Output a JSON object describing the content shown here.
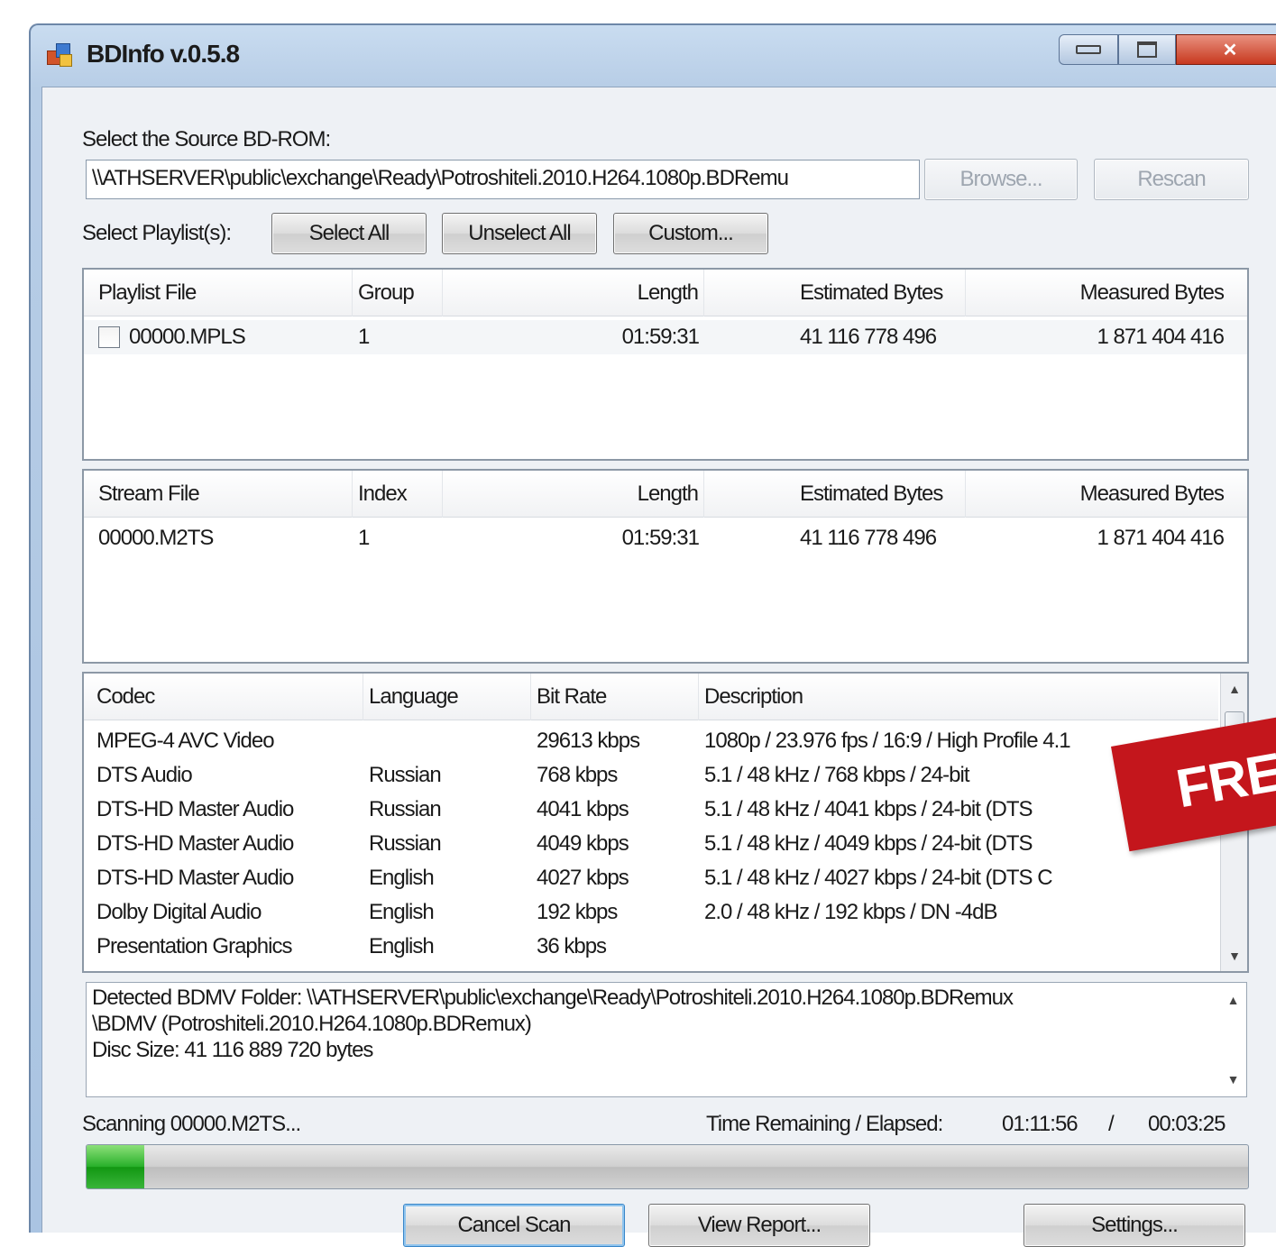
{
  "window": {
    "title": "BDInfo v.0.5.8"
  },
  "source": {
    "label": "Select the Source BD-ROM:",
    "path": "\\\\ATHSERVER\\public\\exchange\\Ready\\Potroshiteli.2010.H264.1080p.BDRemu",
    "browse": "Browse...",
    "rescan": "Rescan"
  },
  "playlists": {
    "label": "Select Playlist(s):",
    "select_all": "Select All",
    "unselect_all": "Unselect All",
    "custom": "Custom...",
    "columns": [
      "Playlist File",
      "Group",
      "Length",
      "Estimated Bytes",
      "Measured Bytes"
    ],
    "rows": [
      {
        "file": "00000.MPLS",
        "group": "1",
        "length": "01:59:31",
        "estimated": "41 116 778 496",
        "measured": "1 871 404 416",
        "checked": false
      }
    ]
  },
  "streams": {
    "columns": [
      "Stream File",
      "Index",
      "Length",
      "Estimated Bytes",
      "Measured Bytes"
    ],
    "rows": [
      {
        "file": "00000.M2TS",
        "index": "1",
        "length": "01:59:31",
        "estimated": "41 116 778 496",
        "measured": "1 871 404 416"
      }
    ]
  },
  "codecs": {
    "columns": [
      "Codec",
      "Language",
      "Bit Rate",
      "Description"
    ],
    "rows": [
      {
        "codec": "MPEG-4 AVC Video",
        "language": "",
        "bitrate": "29613 kbps",
        "description": "1080p / 23.976 fps / 16:9 / High Profile 4.1"
      },
      {
        "codec": "DTS Audio",
        "language": "Russian",
        "bitrate": "768 kbps",
        "description": "5.1 / 48 kHz / 768 kbps / 24-bit"
      },
      {
        "codec": "DTS-HD Master Audio",
        "language": "Russian",
        "bitrate": "4041 kbps",
        "description": "5.1 / 48 kHz / 4041 kbps / 24-bit (DTS"
      },
      {
        "codec": "DTS-HD Master Audio",
        "language": "Russian",
        "bitrate": "4049 kbps",
        "description": "5.1 / 48 kHz / 4049 kbps / 24-bit (DTS"
      },
      {
        "codec": "DTS-HD Master Audio",
        "language": "English",
        "bitrate": "4027 kbps",
        "description": "5.1 / 48 kHz / 4027 kbps / 24-bit (DTS C"
      },
      {
        "codec": "Dolby Digital Audio",
        "language": "English",
        "bitrate": "192 kbps",
        "description": "2.0 / 48 kHz / 192 kbps / DN -4dB"
      },
      {
        "codec": "Presentation Graphics",
        "language": "English",
        "bitrate": "36 kbps",
        "description": ""
      }
    ]
  },
  "log": {
    "line1": "Detected BDMV Folder: \\\\ATHSERVER\\public\\exchange\\Ready\\Potroshiteli.2010.H264.1080p.BDRemux",
    "line2": "\\BDMV (Potroshiteli.2010.H264.1080p.BDRemux)",
    "line3": "Disc Size: 41 116 889 720 bytes"
  },
  "status": {
    "scanning": "Scanning 00000.M2TS...",
    "time_label": "Time Remaining / Elapsed:",
    "remaining": "01:11:56",
    "separator": "/",
    "elapsed": "00:03:25",
    "progress_fraction": 0.05
  },
  "actions": {
    "cancel": "Cancel Scan",
    "view_report": "View Report...",
    "settings": "Settings..."
  },
  "overlay": {
    "stamp_text": "FREE"
  },
  "colors": {
    "progress": "#28b02a",
    "stamp": "#c4161c"
  }
}
